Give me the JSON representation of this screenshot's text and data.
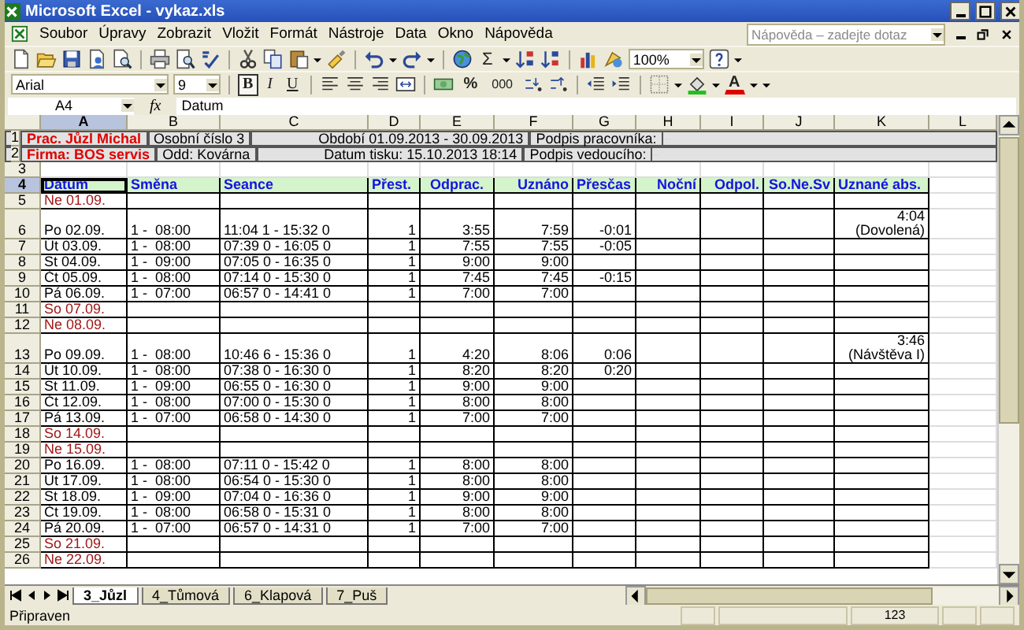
{
  "window": {
    "title": "Microsoft Excel - vykaz.xls"
  },
  "menu": [
    "Soubor",
    "Úpravy",
    "Zobrazit",
    "Vložit",
    "Formát",
    "Nástroje",
    "Data",
    "Okno",
    "Nápověda"
  ],
  "help_box": {
    "placeholder": "Nápověda – zadejte dotaz"
  },
  "standard_toolbar": {
    "sum_symbol": "Σ",
    "zoom": "100%"
  },
  "formatting_toolbar": {
    "font": "Arial",
    "size": "9",
    "bold": {
      "label": "B",
      "on": true
    },
    "italic": {
      "label": "I",
      "on": false
    },
    "underline": {
      "label": "U",
      "on": false
    },
    "percent": "%",
    "thousands": "000",
    "font_color": "A"
  },
  "formula_bar": {
    "cell": "A4",
    "function_label": "fx",
    "value": "Datum"
  },
  "columns": [
    {
      "label": "A",
      "selected": true
    },
    {
      "label": "B",
      "selected": false
    },
    {
      "label": "C",
      "selected": false
    },
    {
      "label": "D",
      "selected": false
    },
    {
      "label": "E",
      "selected": false
    },
    {
      "label": "F",
      "selected": false
    },
    {
      "label": "G",
      "selected": false
    },
    {
      "label": "H",
      "selected": false
    },
    {
      "label": "I",
      "selected": false
    },
    {
      "label": "J",
      "selected": false
    },
    {
      "label": "K",
      "selected": false
    },
    {
      "label": "L",
      "selected": false
    }
  ],
  "rows": [
    {
      "number": "1",
      "selected": false,
      "kind": "info",
      "cells": [
        "Prac. Jůzl Michal",
        "Osobní číslo 3",
        "Období 01.09.2013 - 30.09.2013",
        "Podpis pracovníka:"
      ]
    },
    {
      "number": "2",
      "selected": false,
      "kind": "info",
      "cells": [
        "Firma: BOS servis",
        "Odd: Kovárna",
        "Datum tisku: 15.10.2013 18:14",
        "Podpis vedoucího:"
      ]
    },
    {
      "number": "3",
      "selected": false,
      "kind": "blank"
    },
    {
      "number": "4",
      "selected": true,
      "kind": "header",
      "cells": {
        "A": "Datum",
        "B": "Směna",
        "C": "Seance",
        "D": "Přest.",
        "E": "Odprac.",
        "F": "Uznáno",
        "G": "Přesčas",
        "H": "Noční",
        "I": "Odpol.",
        "J": "So.Ne.Sv",
        "K": "Uznané abs."
      }
    },
    {
      "number": "5",
      "selected": false,
      "kind": "day",
      "weekend": true,
      "cells": {
        "A": "Ne 01.09."
      }
    },
    {
      "number": "6",
      "selected": false,
      "kind": "day",
      "weekend": false,
      "cells": {
        "A": "Po 02.09.",
        "B": "1 -  08:00",
        "C": "11:04 1 - 15:32 0",
        "D": "1",
        "E": "3:55",
        "F": "7:59",
        "G": "-0:01",
        "K": "4:04\n(Dovolená)"
      }
    },
    {
      "number": "7",
      "selected": false,
      "kind": "day",
      "weekend": false,
      "cells": {
        "A": "Út 03.09.",
        "B": "1 -  08:00",
        "C": "07:39 0 - 16:05 0",
        "D": "1",
        "E": "7:55",
        "F": "7:55",
        "G": "-0:05"
      }
    },
    {
      "number": "8",
      "selected": false,
      "kind": "day",
      "weekend": false,
      "cells": {
        "A": "St 04.09.",
        "B": "1 -  09:00",
        "C": "07:05 0 - 16:35 0",
        "D": "1",
        "E": "9:00",
        "F": "9:00"
      }
    },
    {
      "number": "9",
      "selected": false,
      "kind": "day",
      "weekend": false,
      "cells": {
        "A": "Čt 05.09.",
        "B": "1 -  08:00",
        "C": "07:14 0 - 15:30 0",
        "D": "1",
        "E": "7:45",
        "F": "7:45",
        "G": "-0:15"
      }
    },
    {
      "number": "10",
      "selected": false,
      "kind": "day",
      "weekend": false,
      "cells": {
        "A": "Pá 06.09.",
        "B": "1 -  07:00",
        "C": "06:57 0 - 14:41 0",
        "D": "1",
        "E": "7:00",
        "F": "7:00"
      }
    },
    {
      "number": "11",
      "selected": false,
      "kind": "day",
      "weekend": true,
      "cells": {
        "A": "So 07.09."
      }
    },
    {
      "number": "12",
      "selected": false,
      "kind": "day",
      "weekend": true,
      "cells": {
        "A": "Ne 08.09."
      }
    },
    {
      "number": "13",
      "selected": false,
      "kind": "day",
      "weekend": false,
      "cells": {
        "A": "Po 09.09.",
        "B": "1 -  08:00",
        "C": "10:46 6 - 15:36 0",
        "D": "1",
        "E": "4:20",
        "F": "8:06",
        "G": "0:06",
        "K": "3:46\n(Návštěva I)"
      }
    },
    {
      "number": "14",
      "selected": false,
      "kind": "day",
      "weekend": false,
      "cells": {
        "A": "Út 10.09.",
        "B": "1 -  08:00",
        "C": "07:38 0 - 16:30 0",
        "D": "1",
        "E": "8:20",
        "F": "8:20",
        "G": "0:20"
      }
    },
    {
      "number": "15",
      "selected": false,
      "kind": "day",
      "weekend": false,
      "cells": {
        "A": "St 11.09.",
        "B": "1 -  09:00",
        "C": "06:55 0 - 16:30 0",
        "D": "1",
        "E": "9:00",
        "F": "9:00"
      }
    },
    {
      "number": "16",
      "selected": false,
      "kind": "day",
      "weekend": false,
      "cells": {
        "A": "Čt 12.09.",
        "B": "1 -  08:00",
        "C": "07:00 0 - 15:30 0",
        "D": "1",
        "E": "8:00",
        "F": "8:00"
      }
    },
    {
      "number": "17",
      "selected": false,
      "kind": "day",
      "weekend": false,
      "cells": {
        "A": "Pá 13.09.",
        "B": "1 -  07:00",
        "C": "06:58 0 - 14:30 0",
        "D": "1",
        "E": "7:00",
        "F": "7:00"
      }
    },
    {
      "number": "18",
      "selected": false,
      "kind": "day",
      "weekend": true,
      "cells": {
        "A": "So 14.09."
      }
    },
    {
      "number": "19",
      "selected": false,
      "kind": "day",
      "weekend": true,
      "cells": {
        "A": "Ne 15.09."
      }
    },
    {
      "number": "20",
      "selected": false,
      "kind": "day",
      "weekend": false,
      "cells": {
        "A": "Po 16.09.",
        "B": "1 -  08:00",
        "C": "07:11 0 - 15:42 0",
        "D": "1",
        "E": "8:00",
        "F": "8:00"
      }
    },
    {
      "number": "21",
      "selected": false,
      "kind": "day",
      "weekend": false,
      "cells": {
        "A": "Út 17.09.",
        "B": "1 -  08:00",
        "C": "06:54 0 - 15:30 0",
        "D": "1",
        "E": "8:00",
        "F": "8:00"
      }
    },
    {
      "number": "22",
      "selected": false,
      "kind": "day",
      "weekend": false,
      "cells": {
        "A": "St 18.09.",
        "B": "1 -  09:00",
        "C": "07:04 0 - 16:36 0",
        "D": "1",
        "E": "9:00",
        "F": "9:00"
      }
    },
    {
      "number": "23",
      "selected": false,
      "kind": "day",
      "weekend": false,
      "cells": {
        "A": "Čt 19.09.",
        "B": "1 -  08:00",
        "C": "06:58 0 - 15:31 0",
        "D": "1",
        "E": "8:00",
        "F": "8:00"
      }
    },
    {
      "number": "24",
      "selected": false,
      "kind": "day",
      "weekend": false,
      "cells": {
        "A": "Pá 20.09.",
        "B": "1 -  07:00",
        "C": "06:57 0 - 14:31 0",
        "D": "1",
        "E": "7:00",
        "F": "7:00"
      }
    },
    {
      "number": "25",
      "selected": false,
      "kind": "day",
      "weekend": true,
      "cells": {
        "A": "So 21.09."
      }
    },
    {
      "number": "26",
      "selected": false,
      "kind": "day",
      "weekend": true,
      "cells": {
        "A": "Ne 22.09."
      }
    }
  ],
  "sheet_tabs": [
    {
      "label": "3_Jůzl",
      "selected": true
    },
    {
      "label": "4_Tůmová",
      "selected": false
    },
    {
      "label": "6_Klapová",
      "selected": false
    },
    {
      "label": "7_Puš",
      "selected": false
    }
  ],
  "status_bar": {
    "message": "Připraven",
    "indicator": "123"
  }
}
